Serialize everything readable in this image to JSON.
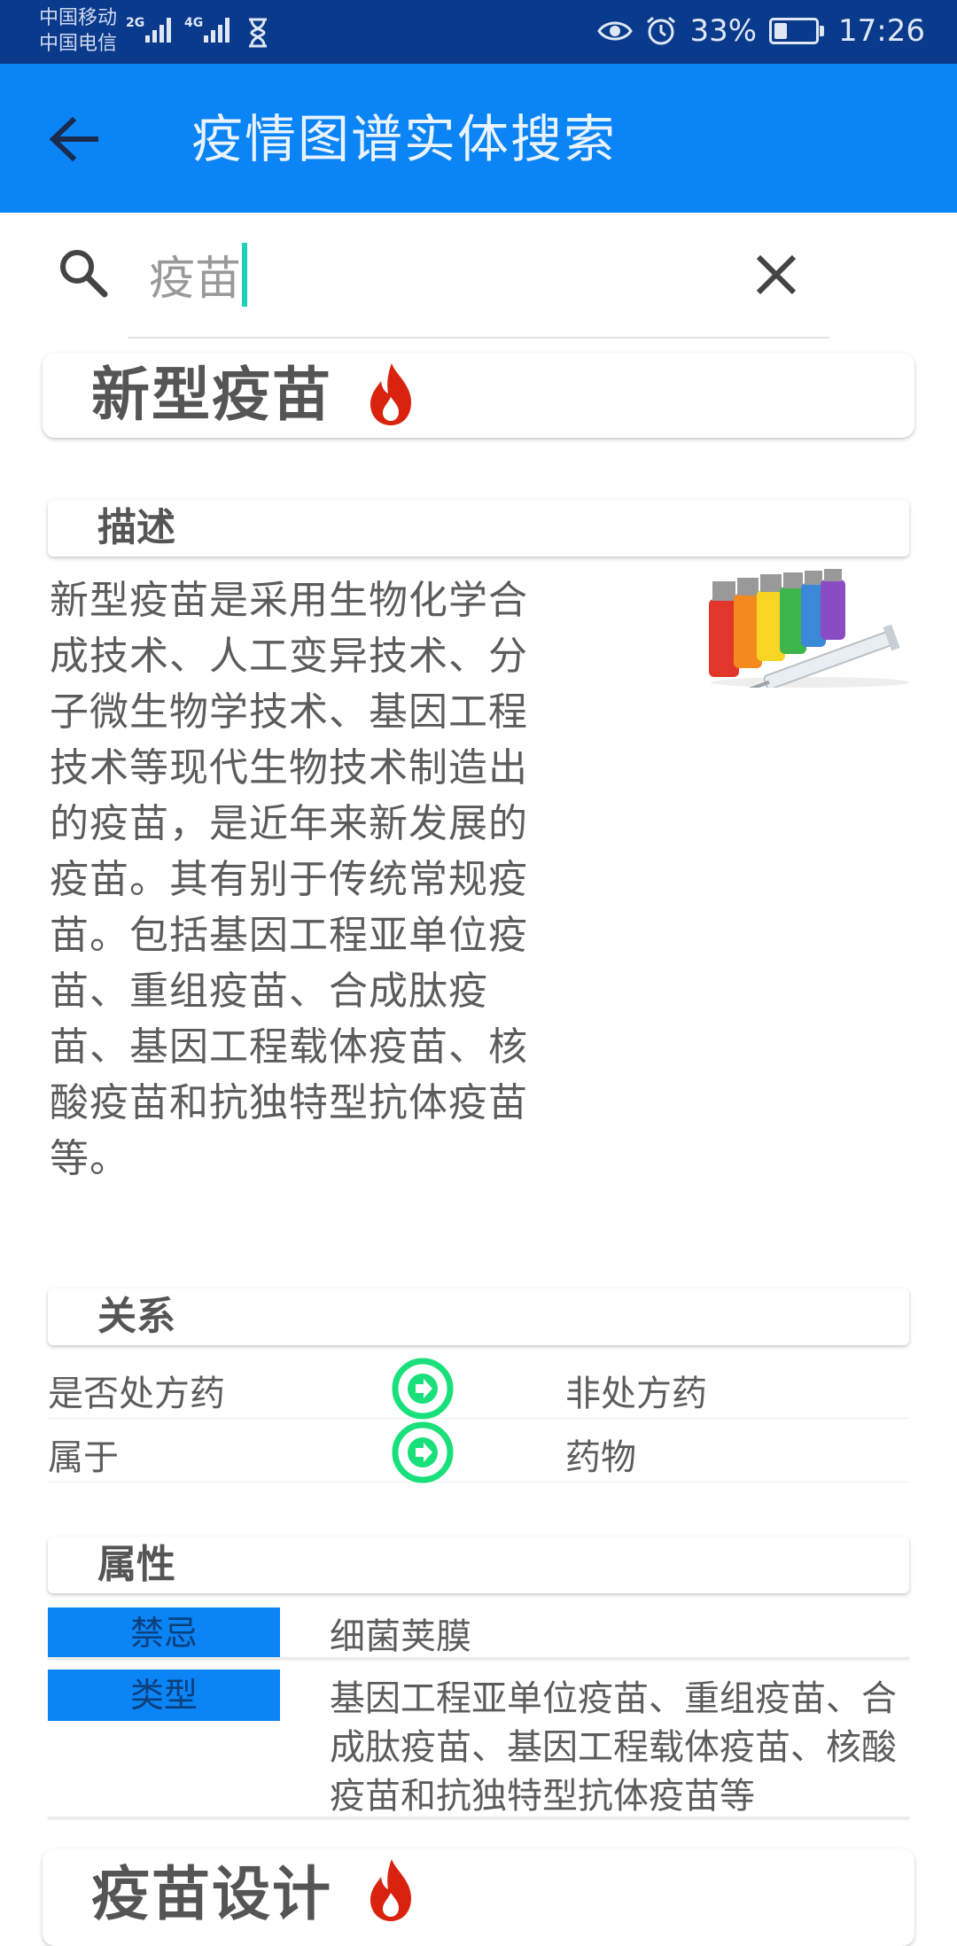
{
  "status_bar": {
    "carrier_1": "中国移动",
    "carrier_2": "中国电信",
    "net_1": "2G",
    "net_2": "4G",
    "battery": "33%",
    "time": "17:26",
    "icons": [
      "signal-icon",
      "hourglass-icon",
      "eye-icon",
      "alarm-icon",
      "battery-icon"
    ]
  },
  "app_bar": {
    "title": "疫情图谱实体搜索",
    "back_icon": "back-arrow-icon"
  },
  "search": {
    "value": "疫苗",
    "icon": "search-icon",
    "clear_icon": "close-icon"
  },
  "entity": {
    "title": "新型疫苗",
    "hot_icon": "fire-icon",
    "description_label": "描述",
    "description": "新型疫苗是采用生物化学合成技术、人工变异技术、分子微生物学技术、基因工程技术等现代生物技术制造出的疫苗，是近年来新发展的疫苗。其有别于传统常规疫苗。包括基因工程亚单位疫苗、重组疫苗、合成肽疫苗、基因工程载体疫苗、核酸疫苗和抗独特型抗体疫苗等。",
    "image": "vaccine-vials-image",
    "relations_label": "关系",
    "relations": [
      {
        "subject": "是否处方药",
        "object": "非处方药"
      },
      {
        "subject": "属于",
        "object": "药物"
      }
    ],
    "properties_label": "属性",
    "properties": [
      {
        "key": "禁忌",
        "value": "细菌荚膜"
      },
      {
        "key": "类型",
        "value": "基因工程亚单位疫苗、重组疫苗、合成肽疫苗、基因工程载体疫苗、核酸疫苗和抗独特型抗体疫苗等"
      }
    ]
  },
  "next_entity": {
    "title": "疫苗设计"
  },
  "colors": {
    "status_bar": "#0a3a8c",
    "app_bar": "#0b84f5",
    "accent": "#1fd1b8",
    "relation_arrow": "#19e07a",
    "fire": "#d9230f"
  }
}
